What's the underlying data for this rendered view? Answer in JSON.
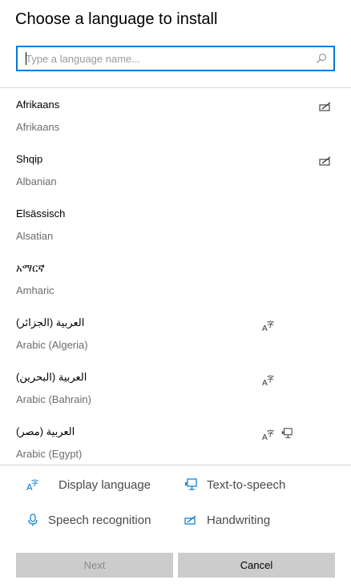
{
  "dialog": {
    "title": "Choose a language to install"
  },
  "search": {
    "placeholder": "Type a language name..."
  },
  "languages": [
    {
      "native": "Afrikaans",
      "english": "Afrikaans",
      "features": [
        "handwriting"
      ]
    },
    {
      "native": "Shqip",
      "english": "Albanian",
      "features": [
        "handwriting"
      ]
    },
    {
      "native": "Elsässisch",
      "english": "Alsatian",
      "features": []
    },
    {
      "native": "አማርኛ",
      "english": "Amharic",
      "features": []
    },
    {
      "native": "العربية (الجزائر)",
      "english": "Arabic (Algeria)",
      "features": [
        "display-language"
      ]
    },
    {
      "native": "العربية (البحرين)",
      "english": "Arabic (Bahrain)",
      "features": [
        "display-language"
      ]
    },
    {
      "native": "العربية (مصر)",
      "english": "Arabic (Egypt)",
      "features": [
        "display-language",
        "text-to-speech"
      ]
    }
  ],
  "legend": {
    "display_language": "Display language",
    "text_to_speech": "Text-to-speech",
    "speech_recognition": "Speech recognition",
    "handwriting": "Handwriting"
  },
  "buttons": {
    "next": "Next",
    "cancel": "Cancel"
  },
  "colors": {
    "accent": "#0078d7",
    "button_bg": "#cccccc",
    "secondary_text": "#6d6d6d"
  }
}
